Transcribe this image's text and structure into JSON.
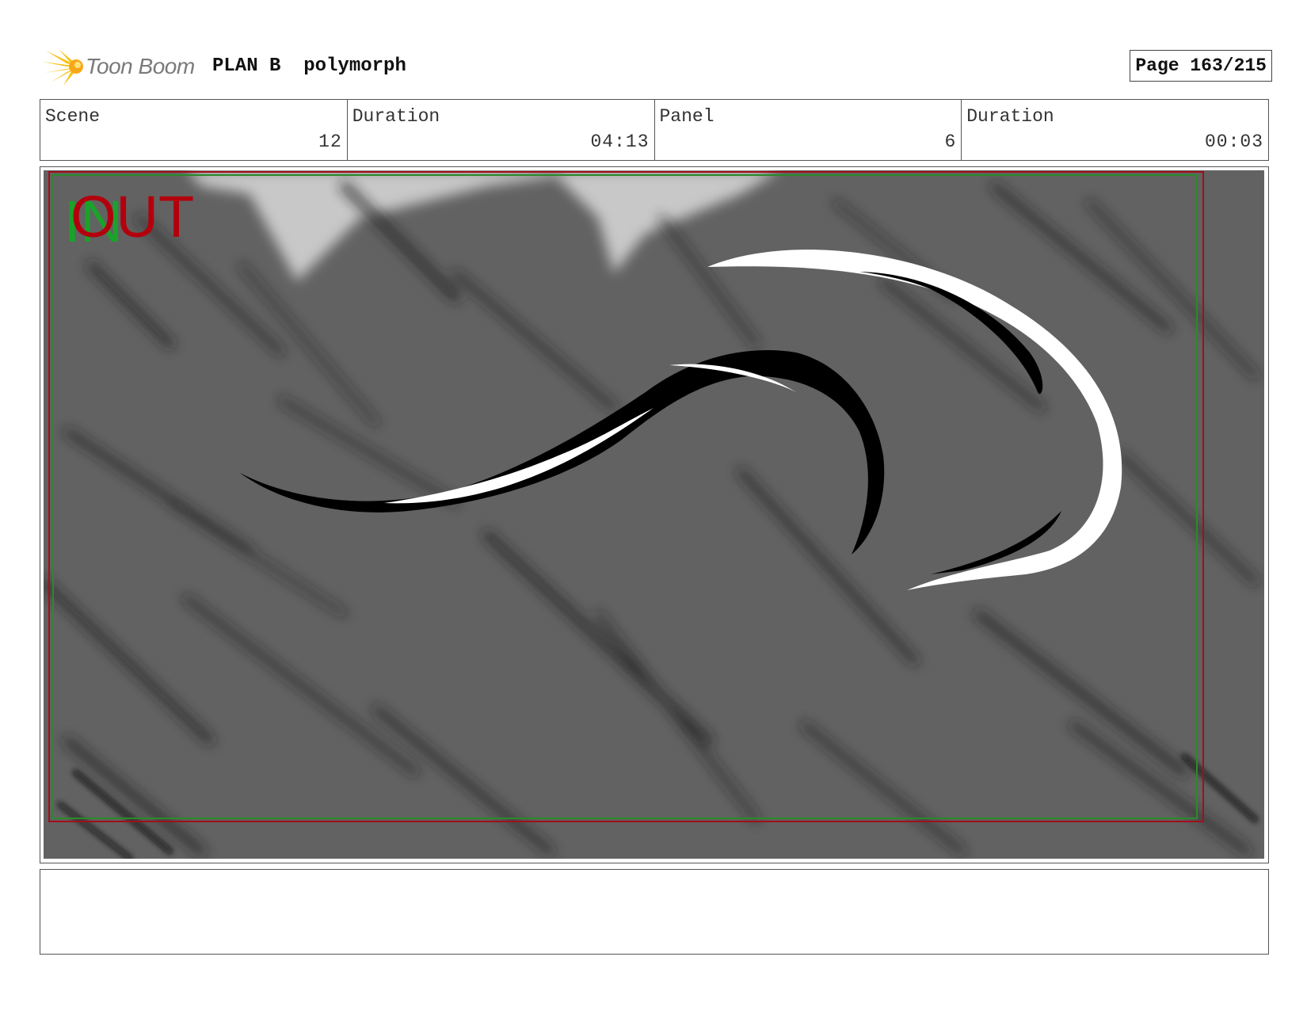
{
  "header": {
    "logo_text": "Toon Boom",
    "project": "PLAN B  polymorph",
    "page": "Page 163/215"
  },
  "info": {
    "scene_label": "Scene",
    "scene_value": "12",
    "duration_label": "Duration",
    "duration_value": "04:13",
    "panel_label": "Panel",
    "panel_value": "6",
    "panel_duration_label": "Duration",
    "panel_duration_value": "00:03"
  },
  "panel": {
    "in_label": "IN",
    "out_label": "OUT"
  },
  "colors": {
    "background_gray": "#626262",
    "sky_gray": "#c8c8c8",
    "in_green": "#1aa329",
    "out_red": "#b3000c",
    "logo_yellow": "#f7c21a"
  }
}
